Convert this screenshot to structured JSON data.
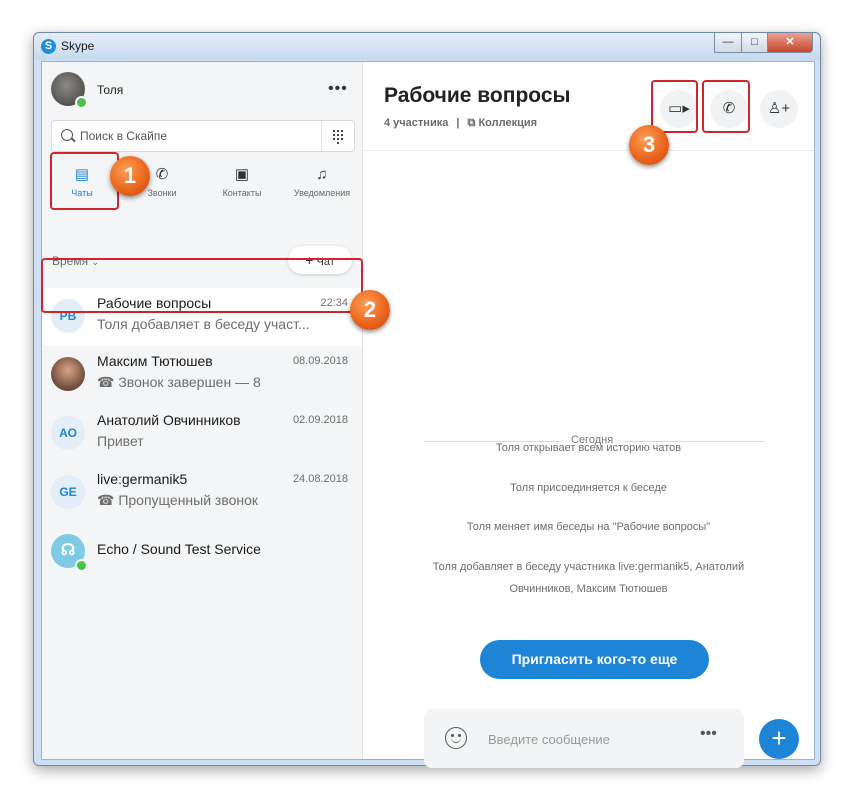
{
  "window": {
    "title": "Skype",
    "controls": {
      "minimize": "—",
      "maximize": "□",
      "close": "✕"
    }
  },
  "profile": {
    "name": "Толя",
    "status_color": "#4cc04d"
  },
  "search": {
    "placeholder": "Поиск в Скайпе"
  },
  "nav": [
    {
      "label": "Чаты",
      "icon": "chat-icon",
      "active": true
    },
    {
      "label": "Звонки",
      "icon": "phone-icon",
      "active": false
    },
    {
      "label": "Контакты",
      "icon": "contacts-icon",
      "active": false
    },
    {
      "label": "Уведомления",
      "icon": "bell-icon",
      "active": false
    }
  ],
  "list_header": {
    "sort_label": "Время",
    "new_chat_label": "Чат"
  },
  "chats": [
    {
      "initials": "РВ",
      "name": "Рабочие вопросы",
      "preview": "Толя добавляет в беседу участ...",
      "date": "22:34",
      "selected": true
    },
    {
      "initials": "",
      "name": "Максим Тютюшев",
      "preview": "☎ Звонок завершен — 8",
      "date": "08.09.2018",
      "selected": false
    },
    {
      "initials": "АО",
      "name": "Анатолий Овчинников",
      "preview": "Привет",
      "date": "02.09.2018",
      "selected": false
    },
    {
      "initials": "GE",
      "name": "live:germanik5",
      "preview": "☎ Пропущенный звонок",
      "date": "24.08.2018",
      "selected": false
    },
    {
      "initials": "",
      "name": "Echo / Sound Test Service",
      "preview": "",
      "date": "",
      "selected": false
    }
  ],
  "conversation": {
    "title": "Рабочие вопросы",
    "participants": "4 участника",
    "divider": "|",
    "collection": "Коллекция",
    "date_separator": "Сегодня",
    "events": [
      "Толя открывает всем историю чатов",
      "Толя присоединяется к беседе",
      "Толя меняет имя беседы на \"Рабочие вопросы\"",
      "Толя добавляет в беседу участника live:germanik5, Анатолий",
      "Овчинников, Максим Тютюшев"
    ],
    "invite_button": "Пригласить кого-то еще",
    "composer_placeholder": "Введите сообщение",
    "composer_more": "•••"
  },
  "annotations": [
    "1",
    "2",
    "3"
  ],
  "colors": {
    "accent": "#1d84d6",
    "highlight": "#d0262b",
    "badge": "#e8621a"
  }
}
